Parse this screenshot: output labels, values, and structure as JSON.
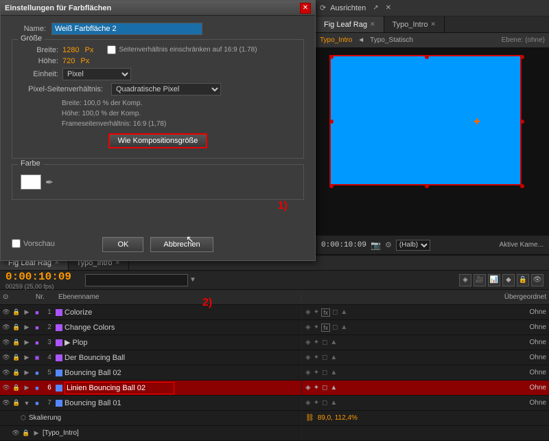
{
  "dialog": {
    "title": "Einstellungen für Farbflächen",
    "name_label": "Name:",
    "name_value": "Weiß Farbfläche 2",
    "size_section": "Größe",
    "breite_label": "Breite:",
    "breite_value": "1280",
    "hoehe_label": "Höhe:",
    "hoehe_value": "720",
    "px": "Px",
    "checkbox_label": "Seitenverhältnis einschränken auf 16:9 (1.78)",
    "einheit_label": "Einheit:",
    "einheit_value": "Pixel",
    "pixel_seitenverhaeltnis_label": "Pixel-Seitenverhältnis:",
    "pixel_seitenverhaeltnis_value": "Quadratische Pixel",
    "info_breite": "Breite: 100,0 % der Komp.",
    "info_hoehe": "Höhe: 100,0 % der Komp.",
    "info_frame": "Frameseitenverhältnis: 16:9 (1,78)",
    "btn_wie_komp": "Wie Kompositionsgröße",
    "farbe_section": "Farbe",
    "preview_label": "Vorschau",
    "btn_ok": "OK",
    "btn_cancel": "Abbrechen",
    "annotation_1": "1)"
  },
  "right_panel": {
    "top_icons": [
      "⟳",
      "↗",
      "✕"
    ],
    "tab1_label": "Fig Leaf Rag",
    "tab1_active": true,
    "tab2_label": "Typo_Intro",
    "sub_label_left": "Typo_Intro",
    "sub_label_right": "Typo_Statisch",
    "sub_arrow": "◄"
  },
  "timeline": {
    "tab1_label": "Fig Leaf Rag",
    "tab2_label": "Typo_Intro",
    "timecode": "0:00:10:09",
    "fps_label": "00259 (25,00 fps)",
    "header_cols": [
      "⊙",
      "Nr.",
      "Ebenenname",
      "Übergeordnet"
    ],
    "layers": [
      {
        "num": "1",
        "color": "#aa55ff",
        "name": "Colorize",
        "has_fx": true,
        "parent": "Ohne"
      },
      {
        "num": "2",
        "color": "#aa55ff",
        "name": "Change Colors",
        "has_fx": true,
        "parent": "Ohne"
      },
      {
        "num": "3",
        "color": "#aa55ff",
        "name": "Plop",
        "has_fx": false,
        "parent": "Ohne"
      },
      {
        "num": "4",
        "color": "#aa55ff",
        "name": "Der Bouncing Ball",
        "has_fx": false,
        "parent": "Ohne"
      },
      {
        "num": "5",
        "color": "#5588ff",
        "name": "Bouncing Ball 02",
        "has_fx": false,
        "parent": "Ohne"
      },
      {
        "num": "6",
        "color": "#5588ff",
        "name": "Linien Bouncing Ball 02",
        "selected": true,
        "has_fx": false,
        "parent": "Ohne"
      },
      {
        "num": "7",
        "color": "#5588ff",
        "name": "Bouncing Ball 01",
        "has_fx": false,
        "parent": "Ohne"
      }
    ],
    "skalierung_row": {
      "num": "",
      "name": "Skalierung",
      "value": "89,0, 112,4%"
    },
    "typo_intro_row": {
      "num": "",
      "name": "[Typo_Intro]"
    },
    "annotation_2": "2)"
  }
}
